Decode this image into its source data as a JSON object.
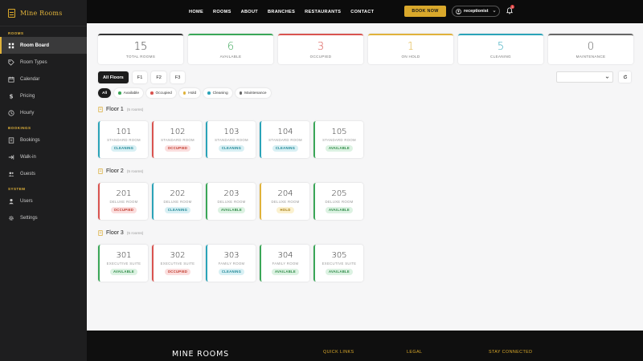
{
  "brand": {
    "name": "Mine Rooms"
  },
  "sidebar": {
    "sections": [
      {
        "title": "ROOMS",
        "items": [
          {
            "label": "Room Board",
            "icon": "grid-icon",
            "active": true
          },
          {
            "label": "Room Types",
            "icon": "tag-icon"
          },
          {
            "label": "Calendar",
            "icon": "calendar-icon"
          },
          {
            "label": "Pricing",
            "icon": "dollar-icon"
          },
          {
            "label": "Hourly",
            "icon": "clock-icon"
          }
        ]
      },
      {
        "title": "BOOKINGS",
        "items": [
          {
            "label": "Bookings",
            "icon": "book-icon"
          },
          {
            "label": "Walk-in",
            "icon": "walk-icon"
          },
          {
            "label": "Guests",
            "icon": "users-icon"
          }
        ]
      },
      {
        "title": "SYSTEM",
        "items": [
          {
            "label": "Users",
            "icon": "user-icon"
          },
          {
            "label": "Settings",
            "icon": "gear-icon"
          }
        ]
      }
    ]
  },
  "topbar": {
    "nav": [
      "HOME",
      "ROOMS",
      "ABOUT",
      "BRANCHES",
      "RESTAURANTS",
      "CONTACT"
    ],
    "book_now": "BOOK NOW",
    "user": "receptionist",
    "notification_count": "3"
  },
  "stats": [
    {
      "value": "15",
      "label": "TOTAL ROOMS",
      "color": "#333333"
    },
    {
      "value": "6",
      "label": "AVAILABLE",
      "color": "#3aa657"
    },
    {
      "value": "3",
      "label": "OCCUPIED",
      "color": "#d9534f"
    },
    {
      "value": "1",
      "label": "ON HOLD",
      "color": "#e0b23a"
    },
    {
      "value": "5",
      "label": "CLEANING",
      "color": "#2aa3b8"
    },
    {
      "value": "0",
      "label": "MAINTENANCE",
      "color": "#666666"
    }
  ],
  "floor_tabs": [
    {
      "label": "All Floors",
      "active": true
    },
    {
      "label": "F1"
    },
    {
      "label": "F2"
    },
    {
      "label": "F3"
    }
  ],
  "filters": [
    {
      "label": "All",
      "active": true
    },
    {
      "label": "Available",
      "color": "#3aa657"
    },
    {
      "label": "Occupied",
      "color": "#d9534f"
    },
    {
      "label": "Hold",
      "color": "#e0b23a"
    },
    {
      "label": "Cleaning",
      "color": "#2aa3b8"
    },
    {
      "label": "Maintenance",
      "color": "#666666"
    }
  ],
  "status_styles": {
    "CLEANING": {
      "border": "#2aa3b8",
      "bg": "#d8f0f4",
      "fg": "#1f8796"
    },
    "OCCUPIED": {
      "border": "#d9534f",
      "bg": "#fbdede",
      "fg": "#c0392b"
    },
    "AVAILABLE": {
      "border": "#3aa657",
      "bg": "#dcf2e2",
      "fg": "#2e8b47"
    },
    "HOLD": {
      "border": "#e0b23a",
      "bg": "#fbf1cf",
      "fg": "#a57b0e"
    }
  },
  "floors": [
    {
      "title": "Floor 1",
      "count": "(5 rooms)",
      "rooms": [
        {
          "number": "101",
          "type": "STANDARD ROOM",
          "status": "CLEANING"
        },
        {
          "number": "102",
          "type": "STANDARD ROOM",
          "status": "OCCUPIED"
        },
        {
          "number": "103",
          "type": "STANDARD ROOM",
          "status": "CLEANING"
        },
        {
          "number": "104",
          "type": "STANDARD ROOM",
          "status": "CLEANING"
        },
        {
          "number": "105",
          "type": "STANDARD ROOM",
          "status": "AVAILABLE"
        }
      ]
    },
    {
      "title": "Floor 2",
      "count": "(5 rooms)",
      "rooms": [
        {
          "number": "201",
          "type": "DELUXE ROOM",
          "status": "OCCUPIED"
        },
        {
          "number": "202",
          "type": "DELUXE ROOM",
          "status": "CLEANING"
        },
        {
          "number": "203",
          "type": "DELUXE ROOM",
          "status": "AVAILABLE"
        },
        {
          "number": "204",
          "type": "DELUXE ROOM",
          "status": "HOLD"
        },
        {
          "number": "205",
          "type": "DELUXE ROOM",
          "status": "AVAILABLE"
        }
      ]
    },
    {
      "title": "Floor 3",
      "count": "(5 rooms)",
      "rooms": [
        {
          "number": "301",
          "type": "EXECUTIVE SUITE",
          "status": "AVAILABLE"
        },
        {
          "number": "302",
          "type": "EXECUTIVE SUITE",
          "status": "OCCUPIED"
        },
        {
          "number": "303",
          "type": "FAMILY ROOM",
          "status": "CLEANING"
        },
        {
          "number": "304",
          "type": "FAMILY ROOM",
          "status": "AVAILABLE"
        },
        {
          "number": "305",
          "type": "EXECUTIVE SUITE",
          "status": "AVAILABLE"
        }
      ]
    }
  ],
  "footer": {
    "brand": "MINE ROOMS",
    "quick_links": "QUICK LINKS",
    "legal": "LEGAL",
    "stay_connected": "STAY CONNECTED"
  }
}
